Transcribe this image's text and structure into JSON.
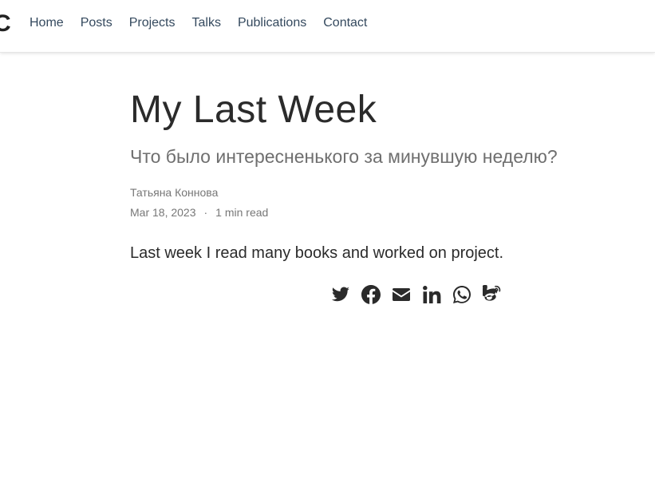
{
  "nav": {
    "brand": "C",
    "links": [
      "Home",
      "Posts",
      "Projects",
      "Talks",
      "Publications",
      "Contact"
    ]
  },
  "post": {
    "title": "My Last Week",
    "subtitle": "Что было интересненького за минувшую неделю?",
    "author": "Татьяна Коннова",
    "date": "Mar 18, 2023",
    "separator": "·",
    "read_time": "1 min read",
    "summary": "Last week I read many books and worked on project."
  },
  "share_icons": [
    "twitter-icon",
    "facebook-icon",
    "envelope-icon",
    "linkedin-icon",
    "whatsapp-icon",
    "weibo-icon"
  ]
}
